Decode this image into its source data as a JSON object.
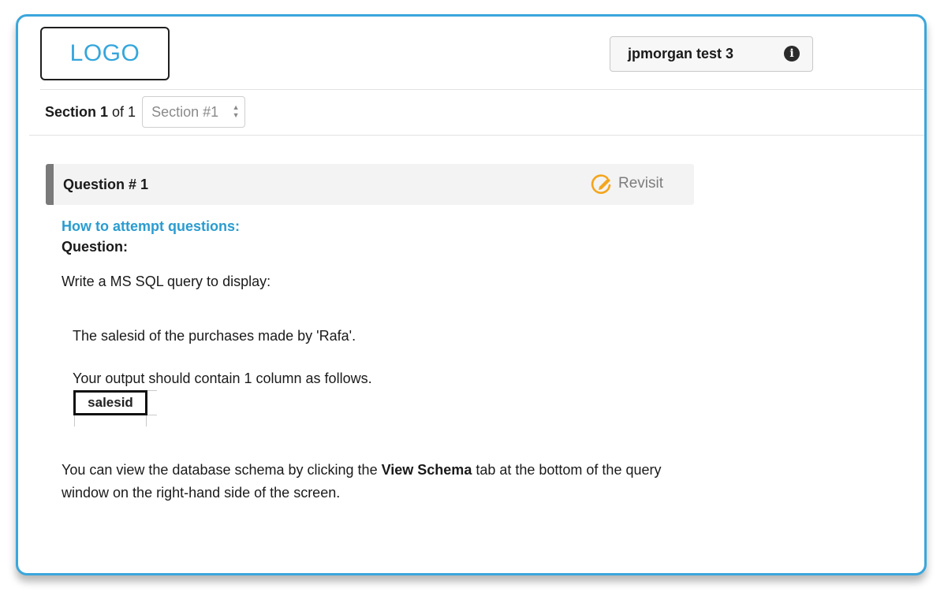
{
  "header": {
    "logo_text": "LOGO",
    "test_name": "jpmorgan test 3",
    "info_icon": "info-circle-icon"
  },
  "section": {
    "label_bold": "Section 1",
    "label_rest": " of 1",
    "select_value": "Section #1"
  },
  "question": {
    "title": "Question # 1",
    "revisit_label": "Revisit",
    "revisit_icon": "pencil-circle-icon",
    "how_to_link": "How to attempt questions:",
    "question_label": "Question:",
    "prompt": "Write a MS SQL query to display:",
    "detail_1": "The salesid of the purchases made by 'Rafa'.",
    "detail_2": "Your output should contain 1 column as follows.",
    "output_columns": [
      "salesid"
    ],
    "schema_note_before": "You can view the database schema by clicking the ",
    "schema_note_bold": "View Schema",
    "schema_note_after": " tab at the bottom of the query window on the right-hand side of the screen."
  },
  "colors": {
    "accent": "#3aa6dc",
    "revisit_orange": "#f4a51c"
  }
}
